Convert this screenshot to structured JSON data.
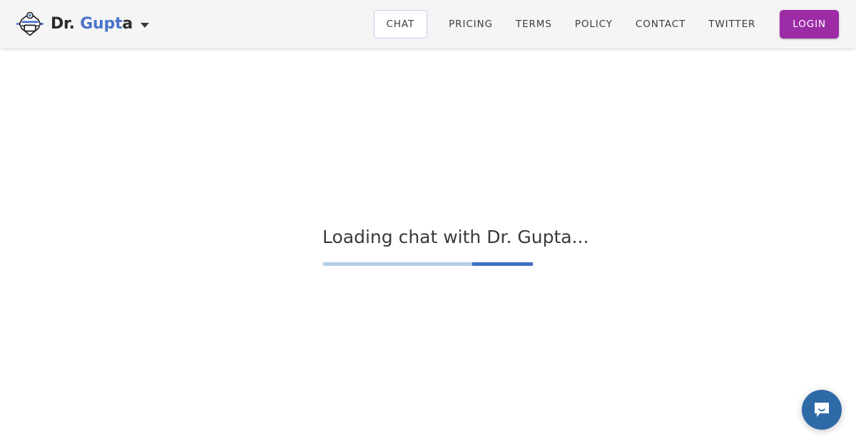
{
  "header": {
    "brand": {
      "logo_icon": "doctor-robot-head-icon",
      "name_full": "Dr. Gupta",
      "name_segment_dark_prefix": "Dr. ",
      "name_segment_blue": "Gupt",
      "name_segment_dark_suffix": "a",
      "caret_icon": "chevron-down-icon"
    },
    "nav": [
      {
        "label": "CHAT",
        "active": true
      },
      {
        "label": "PRICING",
        "active": false
      },
      {
        "label": "TERMS",
        "active": false
      },
      {
        "label": "POLICY",
        "active": false
      },
      {
        "label": "CONTACT",
        "active": false
      },
      {
        "label": "TWITTER",
        "active": false
      }
    ],
    "login_label": "LOGIN"
  },
  "main": {
    "loading_text": "Loading chat with Dr. Gupta...",
    "progress": {
      "indeterminate": true,
      "segment_left_percent": 71,
      "segment_width_percent": 30
    }
  },
  "widget": {
    "launcher_icon": "chat-bubble-smile-icon"
  },
  "colors": {
    "header_bg": "#f5f5f5",
    "body_bg": "#ffffff",
    "brand_blue": "#4a74c9",
    "brand_dark": "#2b2b2b",
    "nav_text": "#3c3c3c",
    "active_tab_border": "#bdd0e8",
    "login_purple": "#9c2ba6",
    "progress_track": "#b5cde9",
    "progress_fill": "#3c6fc0",
    "intercom_blue": "#2f6aa8",
    "loading_text": "#3a3a3a"
  }
}
